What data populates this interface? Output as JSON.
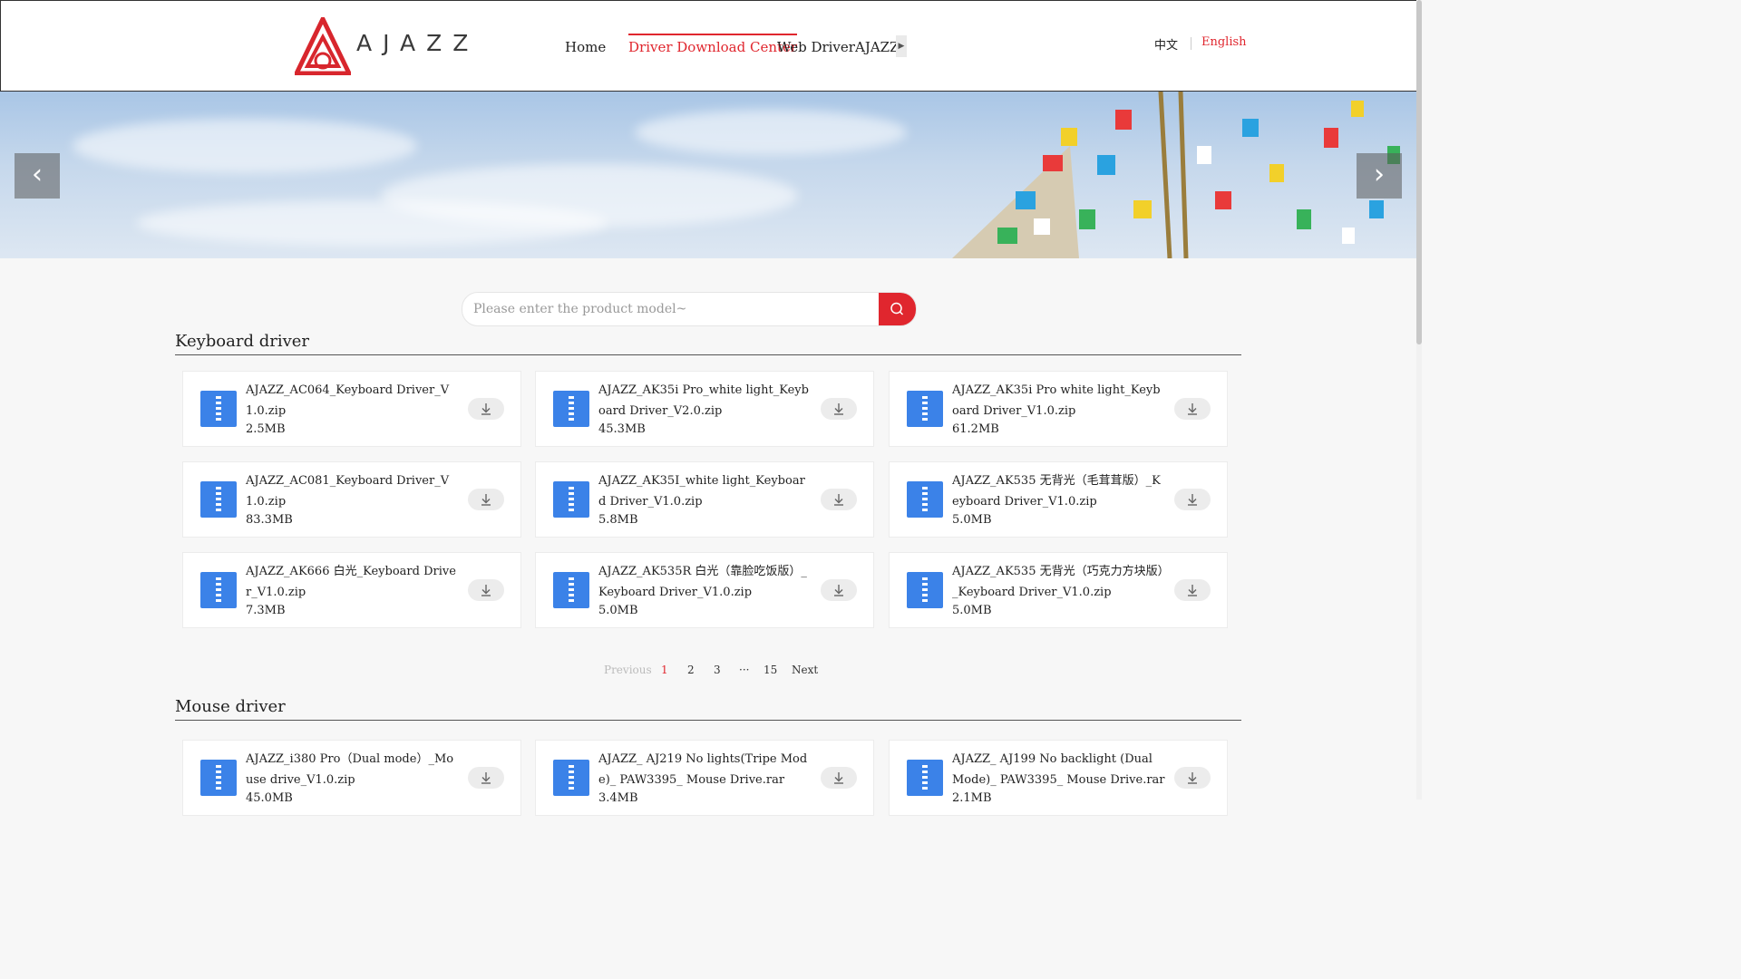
{
  "brand": {
    "logo_text": "AJAZZ",
    "accent_color": "#e0262e"
  },
  "nav": {
    "items": [
      {
        "label": "Home"
      },
      {
        "label": "Driver Download Center"
      },
      {
        "label": "Web Driver"
      },
      {
        "label": "AJAZZ"
      }
    ],
    "active_index": 1,
    "more_icon": "caret-right-icon"
  },
  "lang": {
    "zh": "中文",
    "en": "English",
    "active": "English"
  },
  "banner": {
    "prev_icon": "chevron-left-icon",
    "next_icon": "chevron-right-icon"
  },
  "search": {
    "placeholder": "Please enter the product model~",
    "value": "",
    "icon": "search-icon"
  },
  "sections": [
    {
      "title": "Keyboard driver",
      "files": [
        {
          "name": "AJAZZ_AC064_Keyboard Driver_V1.0.zip",
          "size": "2.5MB"
        },
        {
          "name": "AJAZZ_AK35i Pro_white light_Keyboard Driver_V2.0.zip",
          "size": "45.3MB"
        },
        {
          "name": "AJAZZ_AK35i Pro white light_Keyboard Driver_V1.0.zip",
          "size": "61.2MB"
        },
        {
          "name": "AJAZZ_AC081_Keyboard Driver_V1.0.zip",
          "size": "83.3MB"
        },
        {
          "name": "AJAZZ_AK35I_white light_Keyboard Driver_V1.0.zip",
          "size": "5.8MB"
        },
        {
          "name": "AJAZZ_AK535 无背光（毛茸茸版）_Keyboard Driver_V1.0.zip",
          "size": "5.0MB"
        },
        {
          "name": "AJAZZ_AK666 白光_Keyboard Driver_V1.0.zip",
          "size": "7.3MB"
        },
        {
          "name": "AJAZZ_AK535R 白光（靠脸吃饭版）_Keyboard Driver_V1.0.zip",
          "size": "5.0MB"
        },
        {
          "name": "AJAZZ_AK535 无背光（巧克力方块版）_Keyboard Driver_V1.0.zip",
          "size": "5.0MB"
        }
      ],
      "pagination": {
        "previous": "Previous",
        "pages": [
          "1",
          "2",
          "3",
          "···",
          "15"
        ],
        "current": "1",
        "next": "Next"
      }
    },
    {
      "title": "Mouse driver",
      "files": [
        {
          "name": "AJAZZ_i380 Pro（Dual mode）_Mouse drive_V1.0.zip",
          "size": "45.0MB"
        },
        {
          "name": "AJAZZ_ AJ219 No lights(Tripe Mode)_ PAW3395_ Mouse Drive.rar",
          "size": "3.4MB"
        },
        {
          "name": "AJAZZ_ AJ199 No backlight (Dual Mode)_ PAW3395_ Mouse Drive.rar",
          "size": "2.1MB"
        }
      ]
    }
  ],
  "icons": {
    "file": "zip-file-icon",
    "download": "download-icon"
  }
}
